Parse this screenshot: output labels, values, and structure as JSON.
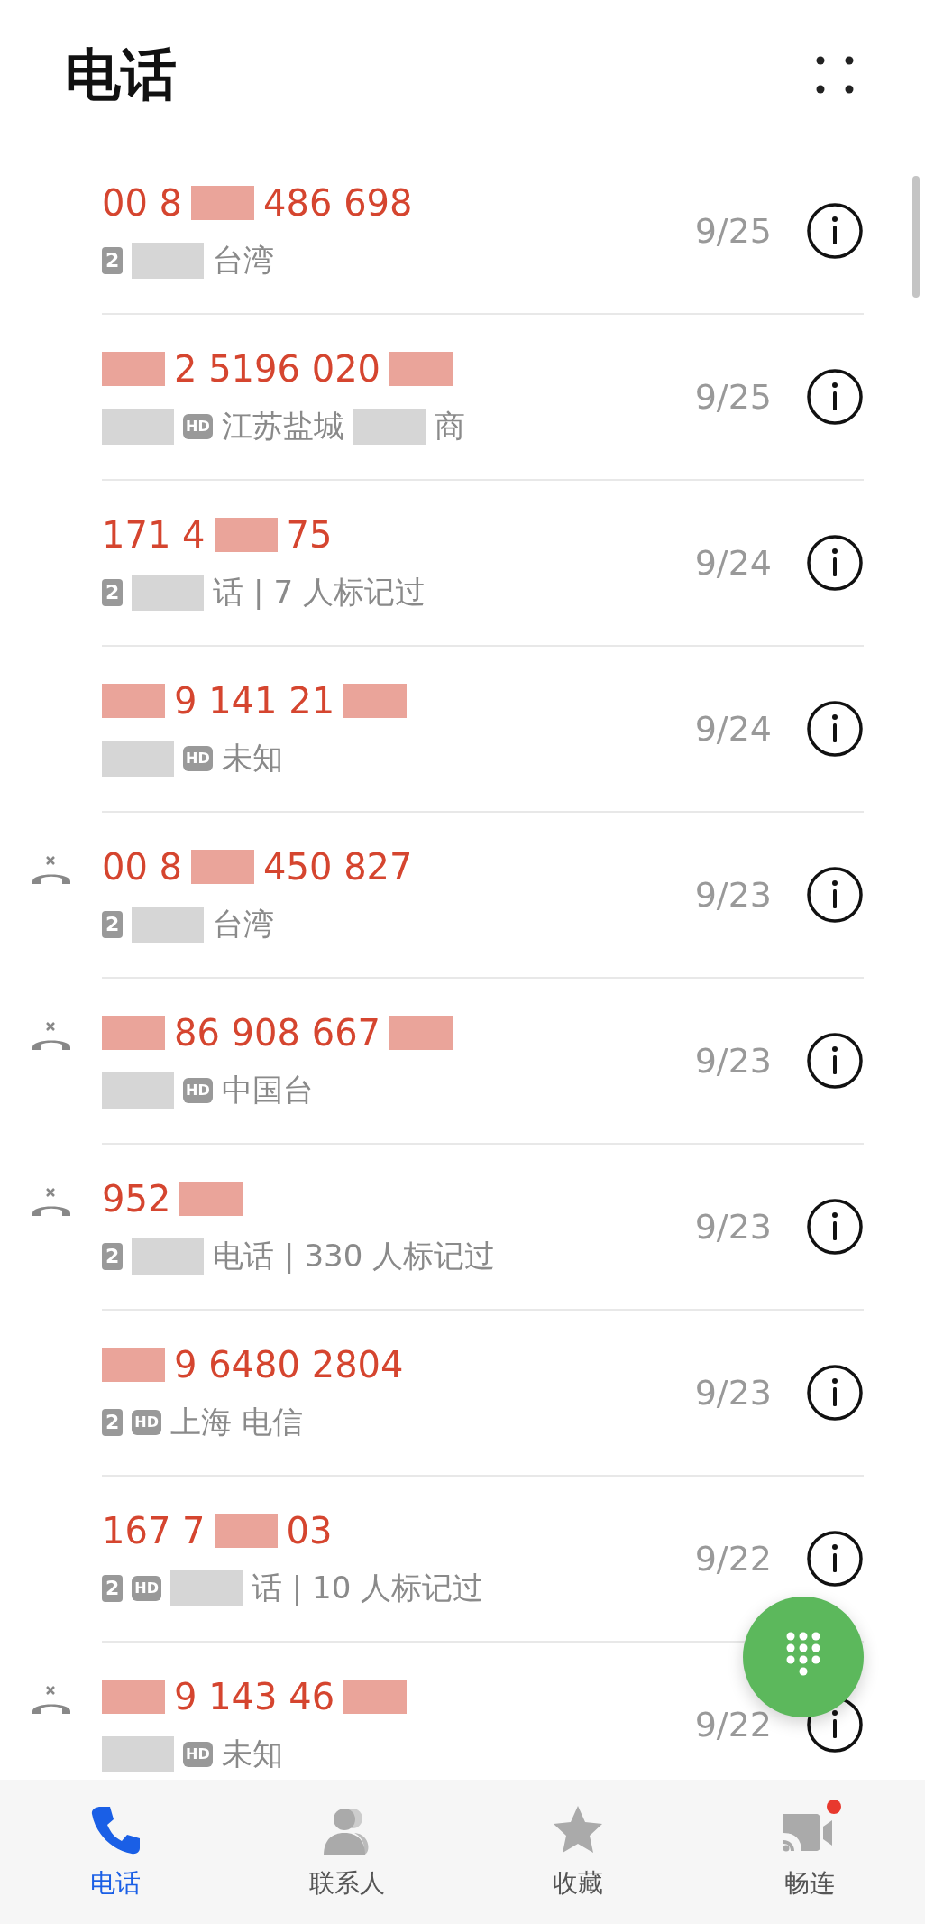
{
  "header": {
    "title": "电话"
  },
  "calls": [
    {
      "missed": false,
      "number": [
        {
          "kind": "text",
          "text": "00 8"
        },
        {
          "kind": "redacted"
        },
        {
          "kind": "text",
          "text": "486 698"
        }
      ],
      "details": [
        {
          "kind": "sim",
          "text": "2"
        },
        {
          "kind": "redacted"
        },
        {
          "kind": "text",
          "text": "台湾"
        }
      ],
      "date": "9/25"
    },
    {
      "missed": false,
      "number": [
        {
          "kind": "redacted"
        },
        {
          "kind": "text",
          "text": "2 5196 020"
        },
        {
          "kind": "redacted"
        }
      ],
      "details": [
        {
          "kind": "redacted"
        },
        {
          "kind": "hd",
          "text": "HD"
        },
        {
          "kind": "text",
          "text": "江苏盐城"
        },
        {
          "kind": "redacted"
        },
        {
          "kind": "text",
          "text": "商"
        }
      ],
      "date": "9/25"
    },
    {
      "missed": false,
      "number": [
        {
          "kind": "text",
          "text": "171 4"
        },
        {
          "kind": "redacted"
        },
        {
          "kind": "text",
          "text": "75"
        }
      ],
      "details": [
        {
          "kind": "sim",
          "text": "2"
        },
        {
          "kind": "redacted"
        },
        {
          "kind": "text",
          "text": "话 | 7 人标记过"
        }
      ],
      "date": "9/24"
    },
    {
      "missed": false,
      "number": [
        {
          "kind": "redacted"
        },
        {
          "kind": "text",
          "text": "9 141 21"
        },
        {
          "kind": "redacted"
        }
      ],
      "details": [
        {
          "kind": "redacted"
        },
        {
          "kind": "hd",
          "text": "HD"
        },
        {
          "kind": "text",
          "text": "未知"
        }
      ],
      "date": "9/24"
    },
    {
      "missed": true,
      "number": [
        {
          "kind": "text",
          "text": "00 8"
        },
        {
          "kind": "redacted"
        },
        {
          "kind": "text",
          "text": "450 827"
        }
      ],
      "details": [
        {
          "kind": "sim",
          "text": "2"
        },
        {
          "kind": "redacted"
        },
        {
          "kind": "text",
          "text": "台湾"
        }
      ],
      "date": "9/23"
    },
    {
      "missed": true,
      "number": [
        {
          "kind": "redacted"
        },
        {
          "kind": "text",
          "text": "86 908 667"
        },
        {
          "kind": "redacted"
        }
      ],
      "details": [
        {
          "kind": "redacted"
        },
        {
          "kind": "hd",
          "text": "HD"
        },
        {
          "kind": "text",
          "text": "中国台"
        }
      ],
      "date": "9/23"
    },
    {
      "missed": true,
      "number": [
        {
          "kind": "text",
          "text": "952"
        },
        {
          "kind": "redacted"
        }
      ],
      "details": [
        {
          "kind": "sim",
          "text": "2"
        },
        {
          "kind": "redacted"
        },
        {
          "kind": "text",
          "text": "电话 | 330 人标记过"
        }
      ],
      "date": "9/23"
    },
    {
      "missed": false,
      "number": [
        {
          "kind": "redacted"
        },
        {
          "kind": "text",
          "text": "9 6480 2804"
        }
      ],
      "details": [
        {
          "kind": "sim",
          "text": "2"
        },
        {
          "kind": "hd",
          "text": "HD"
        },
        {
          "kind": "text",
          "text": "上海 电信"
        }
      ],
      "date": "9/23"
    },
    {
      "missed": false,
      "number": [
        {
          "kind": "text",
          "text": "167 7"
        },
        {
          "kind": "redacted"
        },
        {
          "kind": "text",
          "text": "03"
        }
      ],
      "details": [
        {
          "kind": "sim",
          "text": "2"
        },
        {
          "kind": "hd",
          "text": "HD"
        },
        {
          "kind": "redacted"
        },
        {
          "kind": "text",
          "text": "话 | 10 人标记过"
        }
      ],
      "date": "9/22"
    },
    {
      "missed": true,
      "number": [
        {
          "kind": "redacted"
        },
        {
          "kind": "text",
          "text": "9 143 46"
        },
        {
          "kind": "redacted"
        }
      ],
      "details": [
        {
          "kind": "redacted"
        },
        {
          "kind": "hd",
          "text": "HD"
        },
        {
          "kind": "text",
          "text": "未知"
        }
      ],
      "date": "9/22"
    }
  ],
  "tabs": [
    {
      "label": "电话",
      "selected": true,
      "badge": false
    },
    {
      "label": "联系人",
      "selected": false,
      "badge": false
    },
    {
      "label": "收藏",
      "selected": false,
      "badge": false
    },
    {
      "label": "畅连",
      "selected": false,
      "badge": true
    }
  ]
}
